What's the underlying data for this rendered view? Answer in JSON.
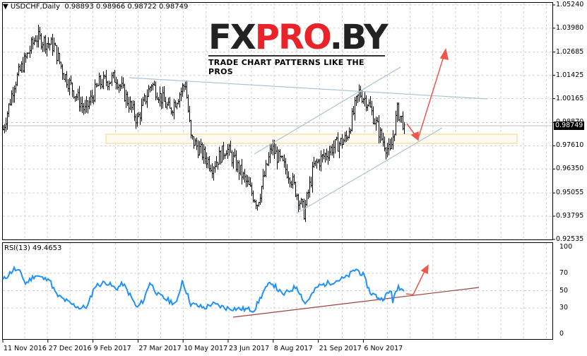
{
  "header": {
    "title": "USDCHF,Daily",
    "ohlc": "0.98893 0.98966 0.98722 0.98749",
    "menu_icon": "triangle-down-icon"
  },
  "logo": {
    "part1": "FX",
    "part2": "PRO",
    "part3": ".BY",
    "tagline": "TRADE CHART PATTERNS LIKE THE PROS"
  },
  "colors": {
    "candle": "#000000",
    "rsi": "#1e90ff",
    "trendline": "#a9c4d6",
    "arrow": "#f0564b",
    "zone": "#f5d58a",
    "rsi_trend": "#a0403a",
    "grid": "#c8c8c8"
  },
  "chart_data": [
    {
      "type": "candlestick",
      "title": "USDCHF,Daily",
      "ylim": [
        0.92535,
        1.0524
      ],
      "y_ticks": [
        "1.05240",
        "1.03980",
        "1.02685",
        "1.01425",
        "1.00165",
        "0.98870",
        "0.97610",
        "0.96350",
        "0.95055",
        "0.93795",
        "0.92535"
      ],
      "current_price": "0.98749",
      "x_ticks": [
        "11 Nov 2016",
        "27 Dec 2016",
        "9 Feb 2017",
        "27 Mar 2017",
        "10 May 2017",
        "23 Jun 2017",
        "8 Aug 2017",
        "21 Sep 2017",
        "6 Nov 2017"
      ],
      "bars": 285,
      "close_path": [
        [
          0,
          0.985
        ],
        [
          8,
          1.01
        ],
        [
          23,
          1.035
        ],
        [
          36,
          1.03
        ],
        [
          43,
          1.015
        ],
        [
          58,
          0.995
        ],
        [
          68,
          1.01
        ],
        [
          80,
          1.013
        ],
        [
          95,
          0.99
        ],
        [
          105,
          1.01
        ],
        [
          118,
          0.995
        ],
        [
          129,
          1.01
        ],
        [
          133,
          0.98
        ],
        [
          148,
          0.965
        ],
        [
          158,
          0.975
        ],
        [
          168,
          0.962
        ],
        [
          180,
          0.945
        ],
        [
          190,
          0.975
        ],
        [
          203,
          0.96
        ],
        [
          213,
          0.94
        ],
        [
          220,
          0.965
        ],
        [
          233,
          0.975
        ],
        [
          243,
          0.98
        ],
        [
          252,
          1.005
        ],
        [
          258,
          1.0
        ],
        [
          268,
          0.98
        ],
        [
          274,
          0.972
        ],
        [
          279,
          0.995
        ],
        [
          284,
          0.98749
        ]
      ]
    },
    {
      "type": "line",
      "title": "RSI(13) 49.4653",
      "ylim": [
        0,
        100
      ],
      "y_ticks": [
        "100",
        "70",
        "50",
        "30",
        "0"
      ],
      "values_path": [
        [
          0,
          62
        ],
        [
          8,
          75
        ],
        [
          13,
          70
        ],
        [
          16,
          58
        ],
        [
          23,
          68
        ],
        [
          30,
          63
        ],
        [
          32,
          66
        ],
        [
          38,
          45
        ],
        [
          48,
          35
        ],
        [
          55,
          30
        ],
        [
          60,
          32
        ],
        [
          65,
          55
        ],
        [
          73,
          60
        ],
        [
          80,
          52
        ],
        [
          85,
          58
        ],
        [
          90,
          45
        ],
        [
          95,
          30
        ],
        [
          100,
          40
        ],
        [
          104,
          60
        ],
        [
          110,
          45
        ],
        [
          118,
          38
        ],
        [
          123,
          35
        ],
        [
          127,
          62
        ],
        [
          133,
          35
        ],
        [
          143,
          30
        ],
        [
          148,
          35
        ],
        [
          158,
          30
        ],
        [
          178,
          28
        ],
        [
          185,
          50
        ],
        [
          190,
          60
        ],
        [
          198,
          45
        ],
        [
          208,
          55
        ],
        [
          214,
          35
        ],
        [
          223,
          55
        ],
        [
          233,
          60
        ],
        [
          243,
          65
        ],
        [
          250,
          75
        ],
        [
          255,
          68
        ],
        [
          260,
          48
        ],
        [
          268,
          40
        ],
        [
          275,
          50
        ],
        [
          276,
          38
        ],
        [
          280,
          55
        ],
        [
          284,
          49.4653
        ]
      ]
    }
  ]
}
